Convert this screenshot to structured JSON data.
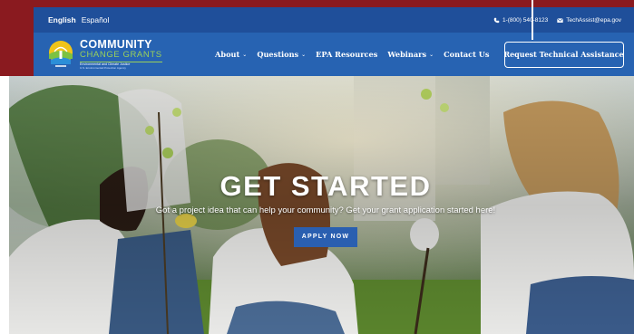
{
  "utility": {
    "lang_en": "English",
    "lang_es": "Español",
    "phone": "1-(800) 540-8123",
    "email": "TechAssist@epa.gov"
  },
  "logo": {
    "title": "COMMUNITY",
    "subtitle": "CHANGE GRANTS",
    "tagline": "Environmental and Climate Justice",
    "agency": "U.S. Environmental Protection Agency"
  },
  "nav": {
    "about": "About",
    "questions": "Questions",
    "epa_resources": "EPA Resources",
    "webinars": "Webinars",
    "contact": "Contact Us",
    "cta": "Request Technical Assistance"
  },
  "hero": {
    "title": "GET STARTED",
    "subtitle": "Got a project idea that can help your community? Get your grant application started here!",
    "button": "APPLY NOW"
  },
  "colors": {
    "frame": "#8a1a1f",
    "utility_bar": "#1f4f9a",
    "header": "#2763b2",
    "accent_green": "#9ad05a",
    "button": "#2a5fb0"
  }
}
